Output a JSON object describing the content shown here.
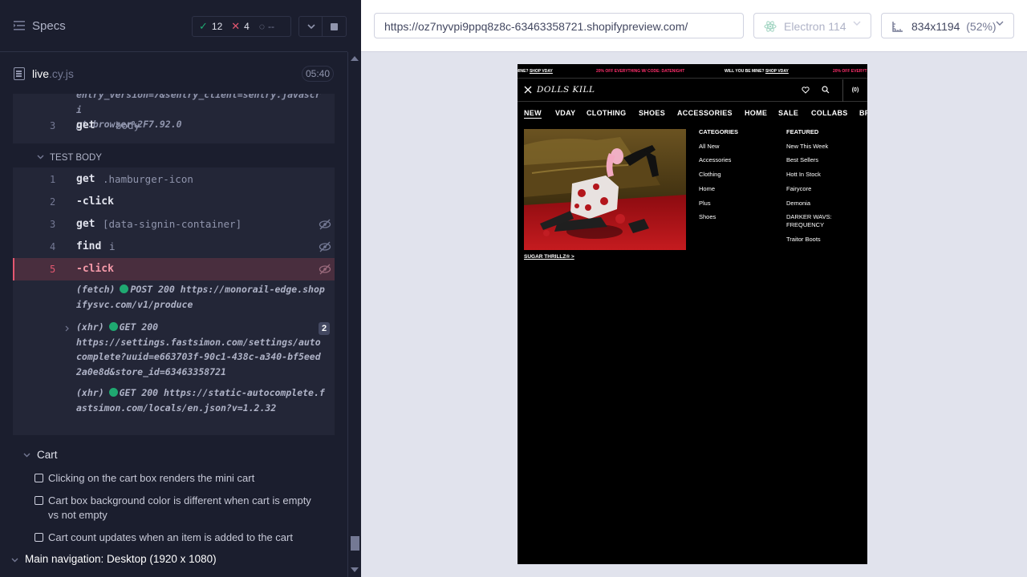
{
  "left": {
    "title": "Specs",
    "stats": {
      "passed": "12",
      "failed": "4",
      "pending": "--"
    },
    "file": {
      "name": "live",
      "ext": ".cy.js",
      "duration": "05:40"
    },
    "reporter": {
      "truncated_log": [
        "entry_version=7&sentry_client=sentry.javascri",
        "pt.browser%2F7.92.0"
      ],
      "prev_cmd": {
        "num": "3",
        "name": "get",
        "arg": "body"
      },
      "section_label": "TEST BODY",
      "commands": [
        {
          "num": "1",
          "name": "get",
          "arg": ".hamburger-icon"
        },
        {
          "num": "2",
          "name": "-click",
          "arg": ""
        },
        {
          "num": "3",
          "name": "get",
          "arg": "[data-signin-container]"
        },
        {
          "num": "4",
          "name": "find",
          "arg": "i"
        },
        {
          "num": "5",
          "name": "-click",
          "arg": ""
        }
      ],
      "logs": [
        {
          "type": "(fetch)",
          "method": "POST 200",
          "url": "https://monorail-edge.shopifysvc.com/v1/produce"
        },
        {
          "type": "(xhr)",
          "method": "GET 200",
          "url": "https://settings.fastsimon.com/settings/autocomplete?uuid=e663703f-90c1-438c-a340-bf5eed2a0e8d&store_id=63463358721",
          "count": "2"
        },
        {
          "type": "(xhr)",
          "method": "GET 200",
          "url": "https://static-autocomplete.fastsimon.com/locals/en.json?v=1.2.32"
        }
      ]
    },
    "cart": {
      "title": "Cart",
      "tests": [
        "Clicking on the cart box renders the mini cart",
        "Cart box background color is different when cart is empty vs not empty",
        "Cart count updates when an item is added to the cart"
      ]
    },
    "next_suite": "Main navigation: Desktop (1920 x 1080)"
  },
  "right": {
    "url": "https://oz7nyvpi9ppq8z8c-63463358721.shopifypreview.com/",
    "browser": "Electron 114",
    "viewport": "834x1194",
    "scale": "(52%)",
    "aut": {
      "announce": [
        {
          "text": "MINE? SHOP VDAY",
          "style": "w"
        },
        {
          "text": "20% OFF EVERYTHING W/ CODE: DATENIGHT",
          "style": "p"
        },
        {
          "text": "WILL YOU BE MINE? SHOP VDAY",
          "style": "w"
        },
        {
          "text": "20% OFF EVERYTH",
          "style": "p"
        }
      ],
      "logo": "DOLLS KILL",
      "cart_label": "(0)",
      "nav": [
        "NEW",
        "VDAY",
        "CLOTHING",
        "SHOES",
        "ACCESSORIES",
        "HOME",
        "SALE",
        "COLLABS",
        "BR"
      ],
      "photo_caption": "SUGAR THRILLZ® >",
      "categories": {
        "title": "CATEGORIES",
        "items": [
          "All New",
          "Accessories",
          "Clothing",
          "Home",
          "Plus",
          "Shoes"
        ]
      },
      "featured": {
        "title": "FEATURED",
        "items": [
          "New This Week",
          "Best Sellers",
          "Hott In Stock",
          "Fairycore",
          "Demonia",
          "DARKER WAVS: FREQUENCY",
          "Traitor Boots"
        ]
      }
    }
  }
}
